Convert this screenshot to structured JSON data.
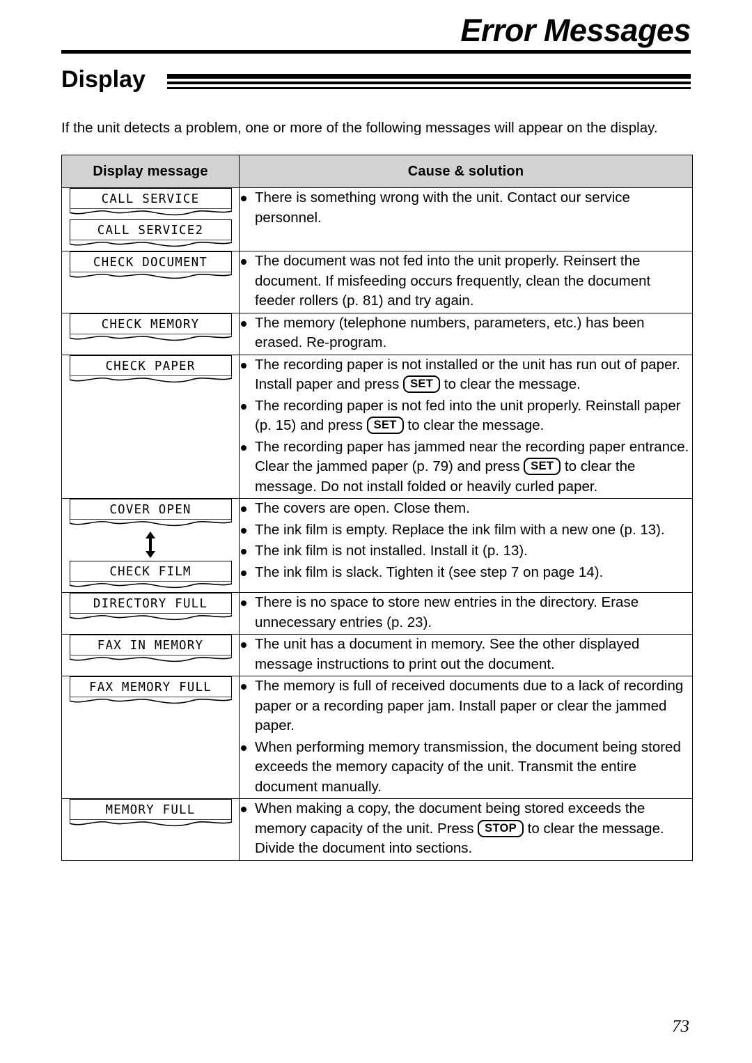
{
  "header": {
    "chapter_title": "Error Messages"
  },
  "section": {
    "heading": "Display",
    "intro": "If the unit detects a problem, one or more of the following messages will appear on the display."
  },
  "table": {
    "columns": [
      "Display message",
      "Cause & solution"
    ],
    "rows": [
      {
        "messages": [
          "CALL SERVICE",
          "CALL SERVICE2"
        ],
        "arrow": false,
        "bullets": [
          {
            "parts": [
              {
                "t": "text",
                "v": "There is something wrong with the unit. Contact our service personnel."
              }
            ]
          }
        ]
      },
      {
        "messages": [
          "CHECK DOCUMENT"
        ],
        "arrow": false,
        "bullets": [
          {
            "parts": [
              {
                "t": "text",
                "v": "The document was not fed into the unit properly. Reinsert the document. If misfeeding occurs frequently, clean the document feeder rollers (p. 81) and try again."
              }
            ]
          }
        ]
      },
      {
        "messages": [
          "CHECK MEMORY"
        ],
        "arrow": false,
        "bullets": [
          {
            "parts": [
              {
                "t": "text",
                "v": "The memory (telephone numbers, parameters, etc.) has been erased. Re-program."
              }
            ]
          }
        ]
      },
      {
        "messages": [
          "CHECK PAPER"
        ],
        "arrow": false,
        "bullets": [
          {
            "parts": [
              {
                "t": "text",
                "v": "The recording paper is not installed or the unit has run out of paper. Install paper and press "
              },
              {
                "t": "key",
                "v": "SET"
              },
              {
                "t": "text",
                "v": " to clear the message."
              }
            ]
          },
          {
            "parts": [
              {
                "t": "text",
                "v": "The recording paper is not fed into the unit properly. Reinstall paper (p. 15) and press "
              },
              {
                "t": "key",
                "v": "SET"
              },
              {
                "t": "text",
                "v": " to clear the message."
              }
            ]
          },
          {
            "parts": [
              {
                "t": "text",
                "v": "The recording paper has jammed near the recording paper entrance. Clear the jammed paper (p. 79) and press "
              },
              {
                "t": "key",
                "v": "SET"
              },
              {
                "t": "text",
                "v": " to clear the message. Do not install folded or heavily curled paper."
              }
            ]
          }
        ]
      },
      {
        "messages": [
          "COVER OPEN",
          "CHECK FILM"
        ],
        "arrow": true,
        "bullets": [
          {
            "parts": [
              {
                "t": "text",
                "v": "The covers are open. Close them."
              }
            ]
          },
          {
            "parts": [
              {
                "t": "text",
                "v": "The ink film is empty. Replace the ink film with a new one (p. 13)."
              }
            ]
          },
          {
            "parts": [
              {
                "t": "text",
                "v": "The ink film is not installed. Install it (p. 13)."
              }
            ]
          },
          {
            "parts": [
              {
                "t": "text",
                "v": "The ink film is slack. Tighten it (see step 7 on page 14)."
              }
            ]
          }
        ]
      },
      {
        "messages": [
          "DIRECTORY FULL"
        ],
        "arrow": false,
        "bullets": [
          {
            "parts": [
              {
                "t": "text",
                "v": "There is no space to store new entries in the directory. Erase unnecessary entries (p. 23)."
              }
            ]
          }
        ]
      },
      {
        "messages": [
          "FAX IN MEMORY"
        ],
        "arrow": false,
        "bullets": [
          {
            "parts": [
              {
                "t": "text",
                "v": "The unit has a document in memory. See the other displayed message instructions to print out the document."
              }
            ]
          }
        ]
      },
      {
        "messages": [
          "FAX MEMORY FULL"
        ],
        "arrow": false,
        "bullets": [
          {
            "parts": [
              {
                "t": "text",
                "v": "The memory is full of received documents due to a lack of recording paper or a recording paper jam. Install paper or clear the jammed paper."
              }
            ]
          },
          {
            "parts": [
              {
                "t": "text",
                "v": "When performing memory transmission, the document being stored exceeds the memory capacity of the unit. Transmit the entire document manually."
              }
            ]
          }
        ]
      },
      {
        "messages": [
          "MEMORY FULL"
        ],
        "arrow": false,
        "bullets": [
          {
            "parts": [
              {
                "t": "text",
                "v": "When making a copy, the document being stored exceeds the memory capacity of the unit. Press "
              },
              {
                "t": "key",
                "v": "STOP"
              },
              {
                "t": "text",
                "v": " to clear the message. Divide the document into sections."
              }
            ]
          }
        ]
      }
    ]
  },
  "footer": {
    "page_number": "73"
  }
}
